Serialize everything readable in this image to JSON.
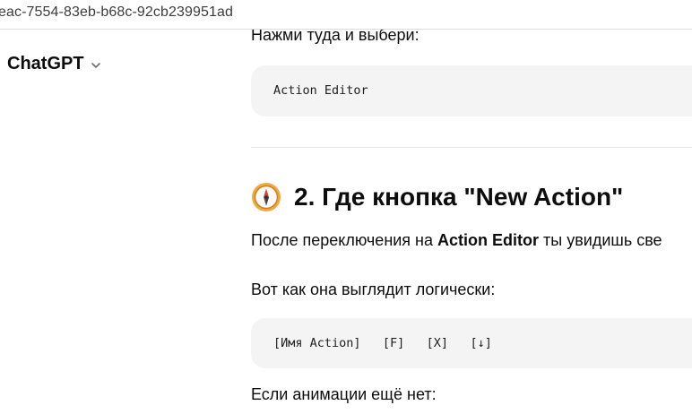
{
  "browser": {
    "url_fragment": "eac-7554-83eb-b68c-92cb239951ad"
  },
  "sidebar": {
    "model_name": "ChatGPT"
  },
  "message": {
    "cut_line": "Нажми туда и выбери:",
    "code_block_1": "Action Editor",
    "section_emoji": "compass-emoji",
    "section_heading": "2. Где кнопка \"New Action\"",
    "para_1_prefix": "После переключения на ",
    "para_1_bold": "Action Editor",
    "para_1_suffix": " ты увидишь све",
    "para_2": "Вот как она выглядит логически:",
    "code_block_2": "[Имя Action]   [F]   [X]   [↓]",
    "para_3": "Если анимации ещё нет:"
  }
}
